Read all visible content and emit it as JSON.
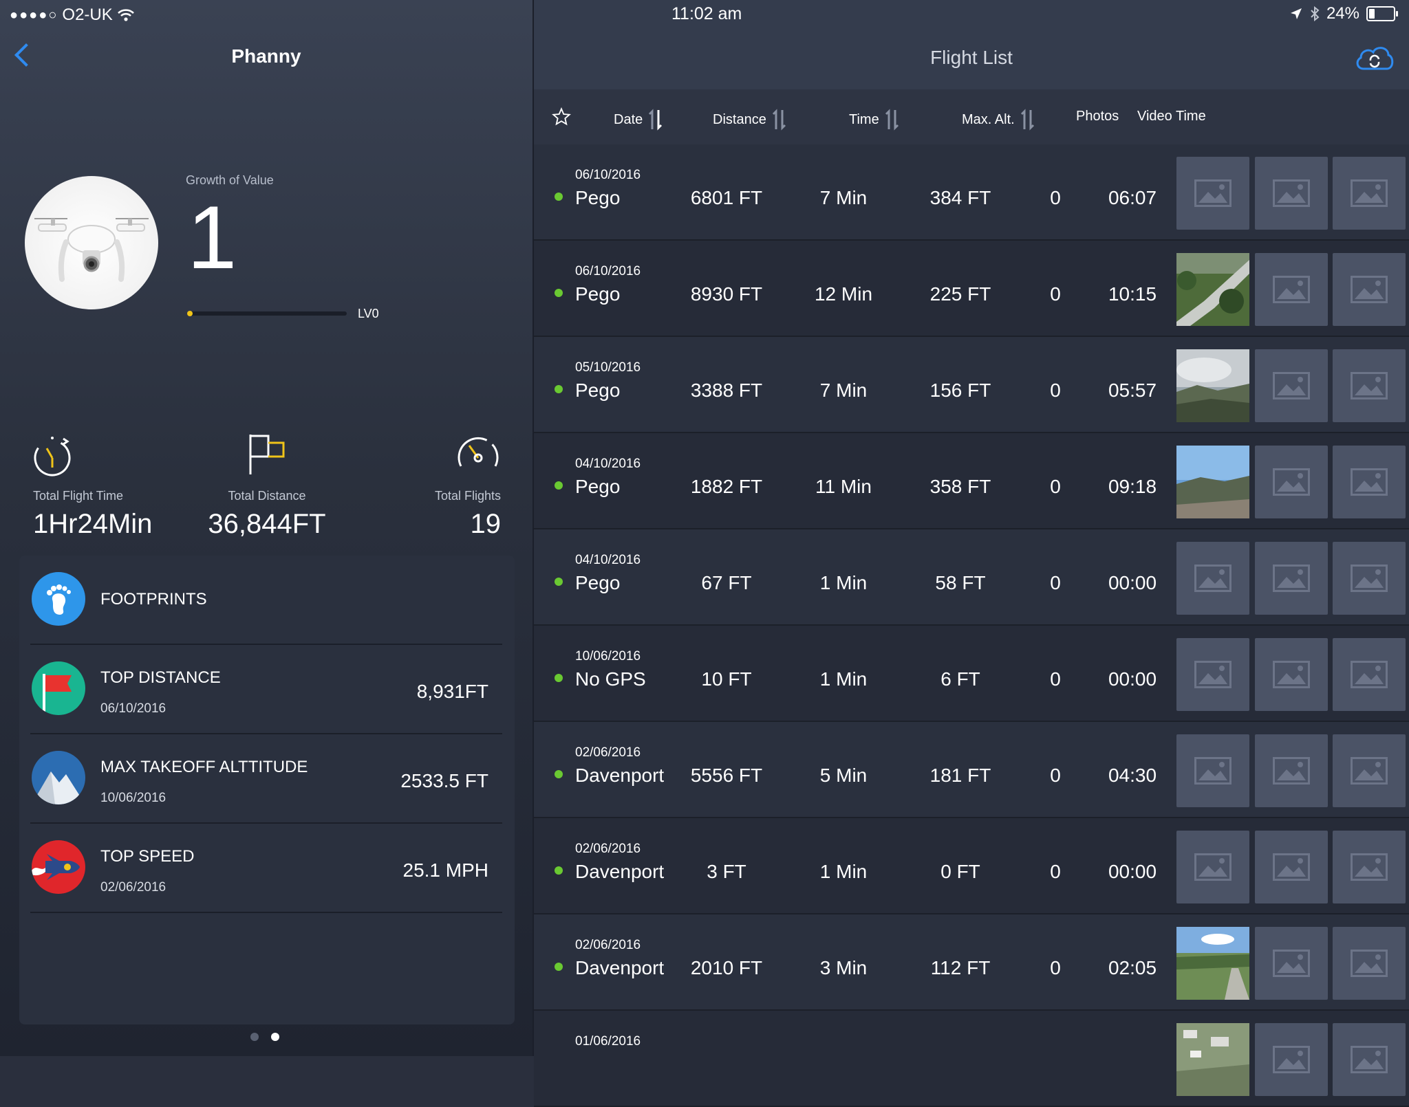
{
  "status_bar": {
    "carrier": "O2-UK",
    "time": "11:02 am",
    "battery": "24%",
    "battery_level": 24
  },
  "profile": {
    "title": "Phanny",
    "growth_label": "Growth of Value",
    "growth_value": "1",
    "level_label": "LV0",
    "level_progress": 0.02
  },
  "stats": [
    {
      "label": "Total Flight Time",
      "value": "1Hr24Min",
      "icon": "stopwatch-icon"
    },
    {
      "label": "Total Distance",
      "value": "36,844FT",
      "icon": "flag-icon"
    },
    {
      "label": "Total Flights",
      "value": "19",
      "icon": "speedometer-icon"
    }
  ],
  "cards": [
    {
      "title": "FOOTPRINTS",
      "date": "",
      "value": "",
      "icon": "footprints-icon"
    },
    {
      "title": "TOP DISTANCE",
      "date": "06/10/2016",
      "value": "8,931FT",
      "icon": "red-flag-icon"
    },
    {
      "title": "MAX TAKEOFF ALTTITUDE",
      "date": "10/06/2016",
      "value": "2533.5 FT",
      "icon": "mountain-icon"
    },
    {
      "title": "TOP SPEED",
      "date": "02/06/2016",
      "value": "25.1 MPH",
      "icon": "rocket-icon"
    }
  ],
  "flight_list": {
    "title": "Flight List",
    "columns": {
      "date": "Date",
      "distance": "Distance",
      "time": "Time",
      "max_alt": "Max. Alt.",
      "photos": "Photos",
      "video_time": "Video Time"
    },
    "rows": [
      {
        "date": "06/10/2016",
        "location": "Pego",
        "distance": "6801 FT",
        "time": "7 Min",
        "max_alt": "384 FT",
        "photos": "0",
        "video_time": "06:07",
        "thumbs": [
          "placeholder",
          "placeholder",
          "placeholder"
        ]
      },
      {
        "date": "06/10/2016",
        "location": "Pego",
        "distance": "8930 FT",
        "time": "12 Min",
        "max_alt": "225 FT",
        "photos": "0",
        "video_time": "10:15",
        "thumbs": [
          "road",
          "placeholder",
          "placeholder"
        ]
      },
      {
        "date": "05/10/2016",
        "location": "Pego",
        "distance": "3388 FT",
        "time": "7 Min",
        "max_alt": "156 FT",
        "photos": "0",
        "video_time": "05:57",
        "thumbs": [
          "clouds",
          "placeholder",
          "placeholder"
        ]
      },
      {
        "date": "04/10/2016",
        "location": "Pego",
        "distance": "1882 FT",
        "time": "11 Min",
        "max_alt": "358 FT",
        "photos": "0",
        "video_time": "09:18",
        "thumbs": [
          "sky",
          "placeholder",
          "placeholder"
        ]
      },
      {
        "date": "04/10/2016",
        "location": "Pego",
        "distance": "67 FT",
        "time": "1 Min",
        "max_alt": "58 FT",
        "photos": "0",
        "video_time": "00:00",
        "thumbs": [
          "placeholder",
          "placeholder",
          "placeholder"
        ]
      },
      {
        "date": "10/06/2016",
        "location": "No GPS",
        "distance": "10 FT",
        "time": "1 Min",
        "max_alt": "6 FT",
        "photos": "0",
        "video_time": "00:00",
        "thumbs": [
          "placeholder",
          "placeholder",
          "placeholder"
        ]
      },
      {
        "date": "02/06/2016",
        "location": "Davenport",
        "distance": "5556 FT",
        "time": "5 Min",
        "max_alt": "181 FT",
        "photos": "0",
        "video_time": "04:30",
        "thumbs": [
          "placeholder",
          "placeholder",
          "placeholder"
        ]
      },
      {
        "date": "02/06/2016",
        "location": "Davenport",
        "distance": "3 FT",
        "time": "1 Min",
        "max_alt": "0 FT",
        "photos": "0",
        "video_time": "00:00",
        "thumbs": [
          "placeholder",
          "placeholder",
          "placeholder"
        ]
      },
      {
        "date": "02/06/2016",
        "location": "Davenport",
        "distance": "2010 FT",
        "time": "3 Min",
        "max_alt": "112 FT",
        "photos": "0",
        "video_time": "02:05",
        "thumbs": [
          "field",
          "placeholder",
          "placeholder"
        ]
      },
      {
        "date": "01/06/2016",
        "location": "",
        "distance": "",
        "time": "",
        "max_alt": "",
        "photos": "",
        "video_time": "",
        "thumbs": [
          "town",
          "placeholder",
          "placeholder"
        ]
      }
    ]
  },
  "pager": {
    "pages": 2,
    "current": 2
  },
  "colors": {
    "accent_blue": "#2f8bf0",
    "gps_dot": "#6ac932",
    "level_dot": "#f0c419"
  }
}
